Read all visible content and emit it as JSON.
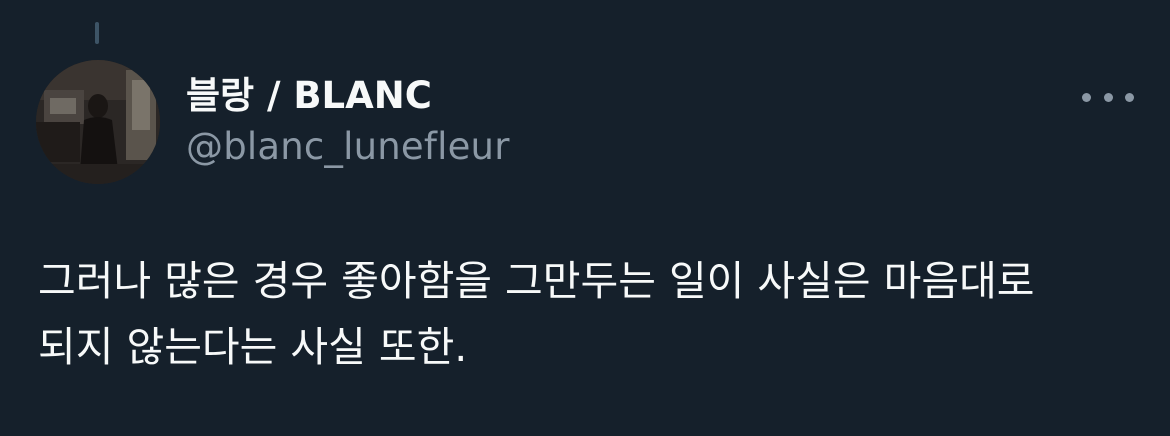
{
  "author": {
    "display_name": "블랑 / BLANC",
    "handle": "@blanc_lunefleur",
    "avatar_icon": "profile-photo"
  },
  "menu": {
    "icon": "more-options-icon"
  },
  "tweet": {
    "lines": [
      "그러나 많은 경우 좋아함을 그만두는 일이 사실은 마음대로",
      "되지 않는다는 사실 또한."
    ]
  },
  "colors": {
    "background": "#15202b",
    "primary_text": "#f7f9f9",
    "secondary_text": "#8b98a5"
  }
}
